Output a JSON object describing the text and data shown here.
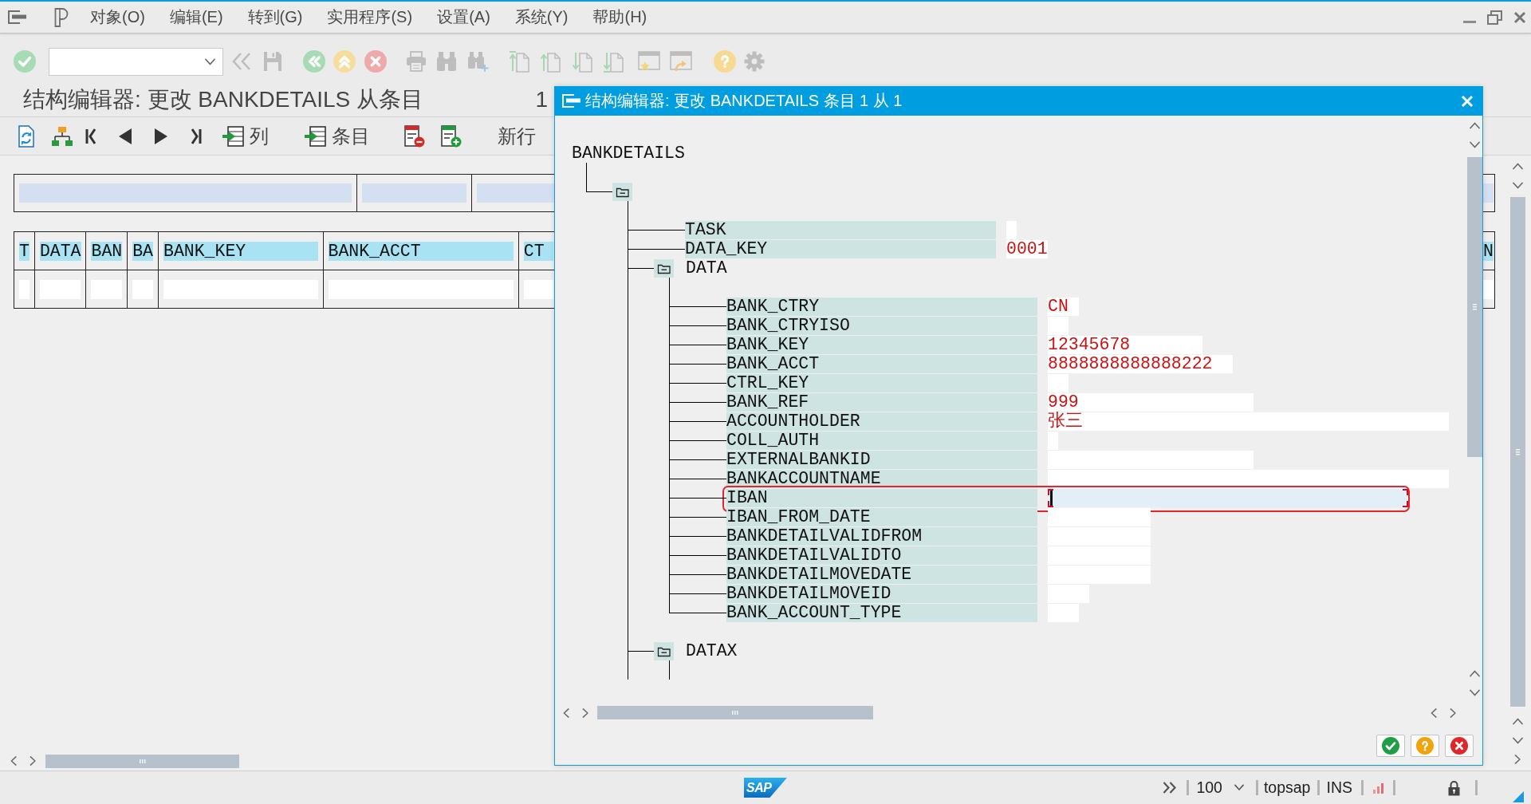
{
  "menu_bar": {
    "items": [
      {
        "label": "对象(O)"
      },
      {
        "label": "编辑(E)"
      },
      {
        "label": "转到(G)"
      },
      {
        "label": "实用程序(S)"
      },
      {
        "label": "设置(A)"
      },
      {
        "label": "系统(Y)"
      },
      {
        "label": "帮助(H)"
      }
    ]
  },
  "screen": {
    "title": "结构编辑器: 更改 BANKDETAILS 从条目",
    "entry_number": "1"
  },
  "app_toolbar": {
    "buttons": [
      {
        "kind": "refresh"
      },
      {
        "kind": "hierarchy"
      },
      {
        "kind": "first"
      },
      {
        "kind": "previous"
      },
      {
        "kind": "next"
      },
      {
        "kind": "last"
      },
      {
        "kind": "columns",
        "label": "列"
      },
      {
        "kind": "entries",
        "label": "条目"
      },
      {
        "kind": "delete_row"
      },
      {
        "kind": "insert_row"
      },
      {
        "kind": "new_row",
        "label": "新行"
      }
    ]
  },
  "table": {
    "columns": [
      {
        "label": "T"
      },
      {
        "label": "DATA"
      },
      {
        "label": "BAN"
      },
      {
        "label": "BA"
      },
      {
        "label": "BANK_KEY"
      },
      {
        "label": "BANK_ACCT"
      },
      {
        "label": "CT"
      }
    ],
    "column_right": {
      "label": "N"
    }
  },
  "dialog": {
    "title": "结构编辑器: 更改 BANKDETAILS 条目 1 从 1",
    "tree": {
      "label": "BANKDETAILS",
      "children": [
        {
          "kind": "folder",
          "expanded": true,
          "children": [
            {
              "kind": "field",
              "label": "TASK",
              "focused": false,
              "highlighted": false
            },
            {
              "kind": "field",
              "label": "DATA_KEY",
              "value": "0001",
              "focused": false,
              "highlighted": false
            },
            {
              "kind": "folder",
              "label": "DATA",
              "expanded": true,
              "children": [
                {
                  "kind": "field",
                  "label": "BANK_CTRY",
                  "value": "CN",
                  "focused": false,
                  "highlighted": false
                },
                {
                  "kind": "field",
                  "label": "BANK_CTRYISO",
                  "focused": false,
                  "highlighted": false
                },
                {
                  "kind": "field",
                  "label": "BANK_KEY",
                  "value": "12345678",
                  "focused": false,
                  "highlighted": false
                },
                {
                  "kind": "field",
                  "label": "BANK_ACCT",
                  "value": "8888888888888222",
                  "focused": false,
                  "highlighted": false
                },
                {
                  "kind": "field",
                  "label": "CTRL_KEY",
                  "focused": false,
                  "highlighted": false
                },
                {
                  "kind": "field",
                  "label": "BANK_REF",
                  "value": "999",
                  "focused": false,
                  "highlighted": false
                },
                {
                  "kind": "field",
                  "label": "ACCOUNTHOLDER",
                  "value": "张三",
                  "focused": false,
                  "highlighted": false
                },
                {
                  "kind": "field",
                  "label": "COLL_AUTH",
                  "focused": false,
                  "highlighted": false
                },
                {
                  "kind": "field",
                  "label": "EXTERNALBANKID",
                  "focused": false,
                  "highlighted": false
                },
                {
                  "kind": "field",
                  "label": "BANKACCOUNTNAME",
                  "focused": false,
                  "highlighted": false
                },
                {
                  "kind": "field",
                  "label": "IBAN",
                  "focused": true,
                  "highlighted": true
                },
                {
                  "kind": "field",
                  "label": "IBAN_FROM_DATE",
                  "focused": false,
                  "highlighted": false
                },
                {
                  "kind": "field",
                  "label": "BANKDETAILVALIDFROM",
                  "focused": false,
                  "highlighted": false
                },
                {
                  "kind": "field",
                  "label": "BANKDETAILVALIDTO",
                  "focused": false,
                  "highlighted": false
                },
                {
                  "kind": "field",
                  "label": "BANKDETAILMOVEDATE",
                  "focused": false,
                  "highlighted": false
                },
                {
                  "kind": "field",
                  "label": "BANKDETAILMOVEID",
                  "focused": false,
                  "highlighted": false
                },
                {
                  "kind": "field",
                  "label": "BANK_ACCOUNT_TYPE",
                  "focused": false,
                  "highlighted": false
                }
              ]
            },
            {
              "kind": "folder",
              "label": "DATAX",
              "expanded": true
            }
          ]
        }
      ]
    },
    "buttons": [
      {
        "kind": "confirm"
      },
      {
        "kind": "help"
      },
      {
        "kind": "cancel"
      }
    ]
  },
  "status_bar": {
    "logo": "SAP",
    "zoom": "100",
    "system": "topsap",
    "mode": "INS"
  }
}
